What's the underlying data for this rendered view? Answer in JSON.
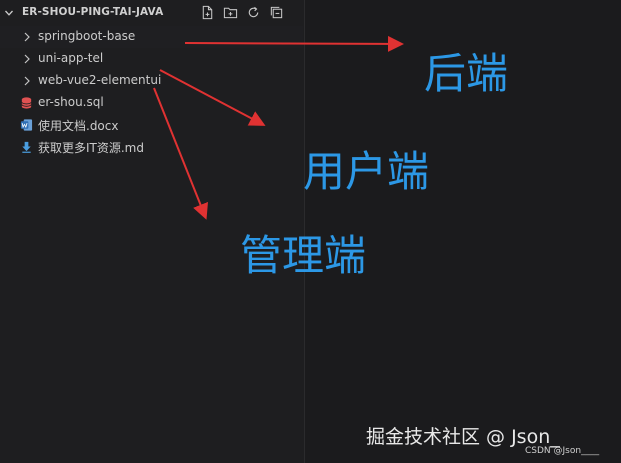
{
  "explorer": {
    "title": "ER-SHOU-PING-TAI-JAVA",
    "actions": [
      {
        "name": "new-file-icon"
      },
      {
        "name": "new-folder-icon"
      },
      {
        "name": "refresh-icon"
      },
      {
        "name": "collapse-all-icon"
      }
    ],
    "items": [
      {
        "label": "springboot-base",
        "type": "folder",
        "icon": "chevron-right-icon"
      },
      {
        "label": "uni-app-tel",
        "type": "folder",
        "icon": "chevron-right-icon"
      },
      {
        "label": "web-vue2-elementui",
        "type": "folder",
        "icon": "chevron-right-icon"
      },
      {
        "label": "er-shou.sql",
        "type": "file",
        "icon": "database-icon",
        "color": "#e05252"
      },
      {
        "label": "使用文档.docx",
        "type": "file",
        "icon": "word-doc-icon",
        "color": "#4a86c8"
      },
      {
        "label": "获取更多IT资源.md",
        "type": "file",
        "icon": "markdown-download-icon",
        "color": "#4a9ee0"
      }
    ]
  },
  "annotations": {
    "backend": "后端",
    "user_side": "用户端",
    "admin_side": "管理端",
    "text_color": "#2c98e6",
    "arrow_color": "#e03232"
  },
  "watermark": {
    "text": "掘金技术社区 @ Json_",
    "credit": "CSDN @Json____"
  }
}
